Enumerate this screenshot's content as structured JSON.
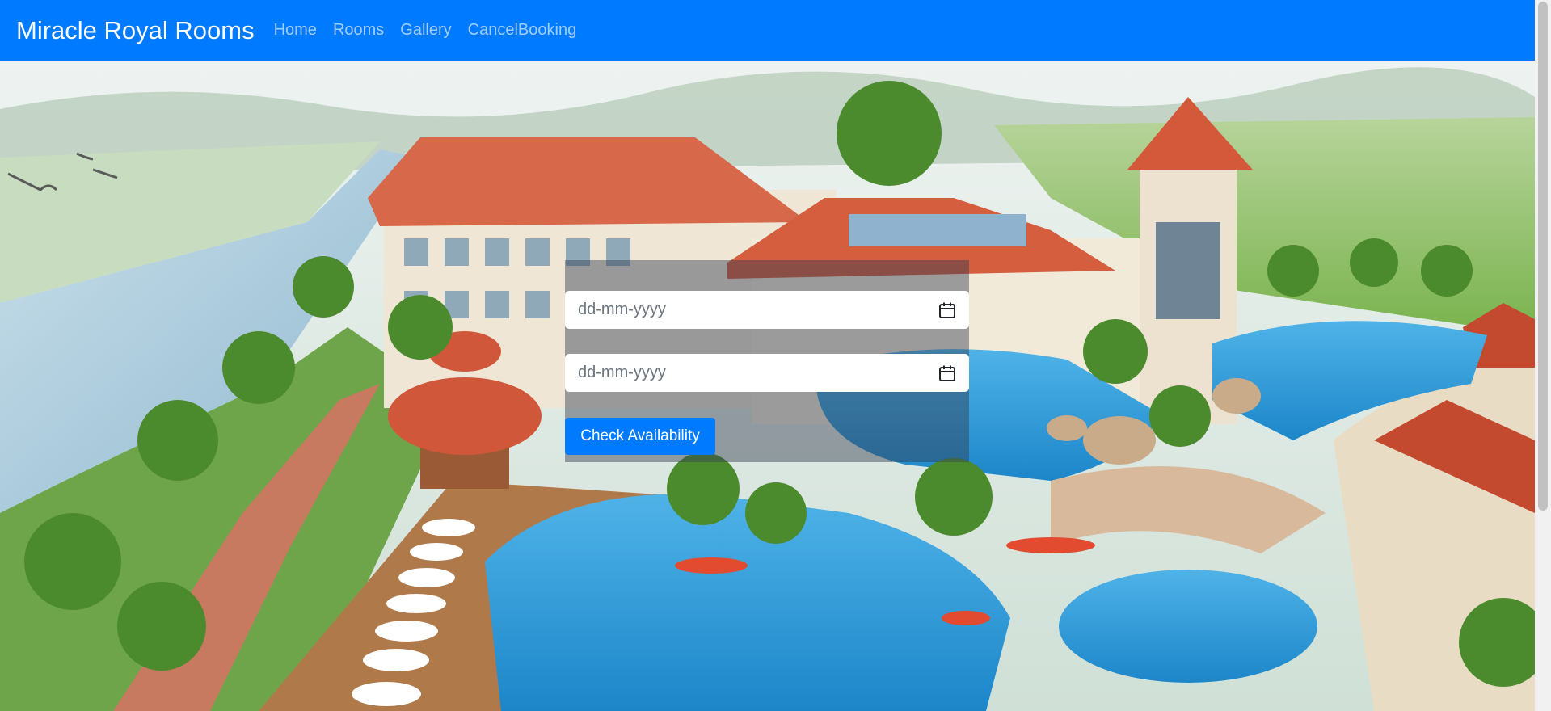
{
  "navbar": {
    "brand": "Miracle Royal Rooms",
    "links": [
      "Home",
      "Rooms",
      "Gallery",
      "CancelBooking"
    ]
  },
  "booking": {
    "checkin_placeholder": "dd-mm-yyyy",
    "checkout_placeholder": "dd-mm-yyyy",
    "button_label": "Check Availability"
  },
  "icons": {
    "date_picker": "calendar-icon"
  },
  "colors": {
    "primary": "#007bff",
    "nav_link": "rgba(255,255,255,0.62)",
    "panel_overlay": "rgba(50,60,80,0.45)"
  }
}
